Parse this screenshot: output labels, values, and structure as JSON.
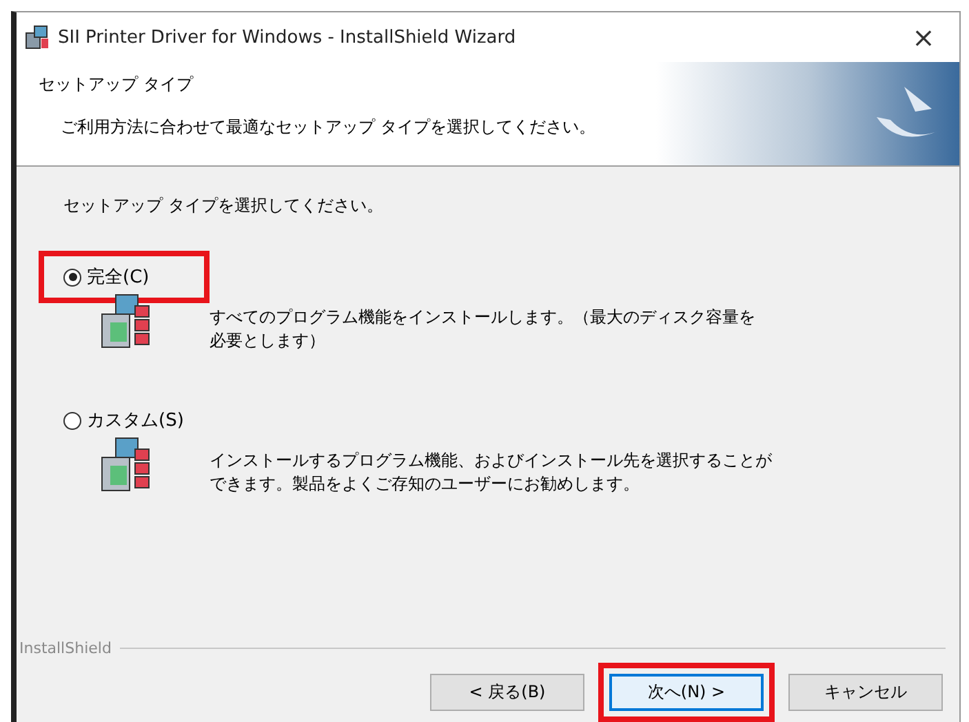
{
  "window": {
    "title": "SII Printer Driver for Windows - InstallShield Wizard",
    "close": "×"
  },
  "header": {
    "title": "セットアップ タイプ",
    "subtitle": "ご利用方法に合わせて最適なセットアップ タイプを選択してください。"
  },
  "prompt": "セットアップ タイプを選択してください。",
  "options": [
    {
      "label": "完全(C)",
      "selected": true,
      "description_lines": [
        "すべてのプログラム機能をインストールします。（最大のディスク容量を",
        "必要とします）"
      ],
      "highlighted": true
    },
    {
      "label": "カスタム(S)",
      "selected": false,
      "description_lines": [
        "インストールするプログラム機能、およびインストール先を選択することが",
        "できます。製品をよくご存知のユーザーにお勧めします。"
      ],
      "highlighted": false
    }
  ],
  "footer_brand": "InstallShield",
  "buttons": [
    {
      "label": "< 戻る(B)",
      "default": false,
      "highlighted": false
    },
    {
      "label": "次へ(N) >",
      "default": true,
      "highlighted": true
    },
    {
      "label": "キャンセル",
      "default": false,
      "highlighted": false
    }
  ]
}
